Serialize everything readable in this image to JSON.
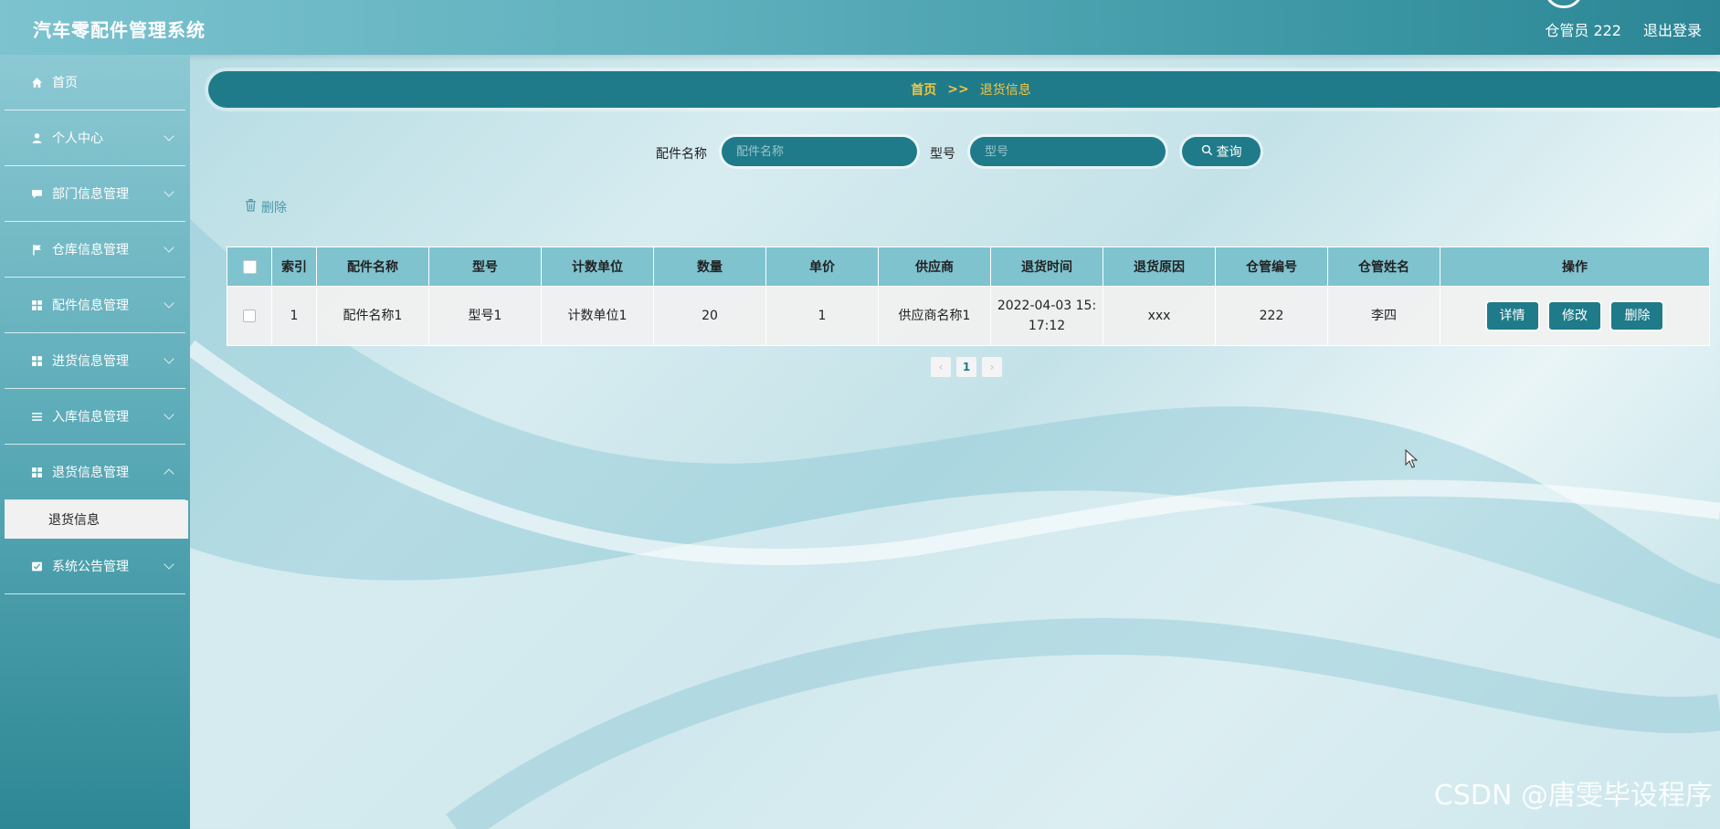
{
  "header": {
    "app_title": "汽车零配件管理系统",
    "user_label": "仓管员 222",
    "logout_label": "退出登录"
  },
  "sidebar": {
    "items": [
      {
        "label": "首页",
        "icon": "home-icon"
      },
      {
        "label": "个人中心",
        "icon": "user-icon"
      },
      {
        "label": "部门信息管理",
        "icon": "chat-icon"
      },
      {
        "label": "仓库信息管理",
        "icon": "flag-icon"
      },
      {
        "label": "配件信息管理",
        "icon": "grid-icon"
      },
      {
        "label": "进货信息管理",
        "icon": "grid-icon"
      },
      {
        "label": "入库信息管理",
        "icon": "list-icon"
      },
      {
        "label": "退货信息管理",
        "icon": "grid-icon"
      },
      {
        "label": "系统公告管理",
        "icon": "notice-icon"
      }
    ],
    "active_sub": "退货信息"
  },
  "breadcrumb": {
    "home": "首页",
    "separator": ">>",
    "current": "退货信息"
  },
  "search": {
    "name_label": "配件名称",
    "name_placeholder": "配件名称",
    "model_label": "型号",
    "model_placeholder": "型号",
    "query_label": "查询"
  },
  "toolbar": {
    "delete_label": "删除"
  },
  "table": {
    "columns": [
      "索引",
      "配件名称",
      "型号",
      "计数单位",
      "数量",
      "单价",
      "供应商",
      "退货时间",
      "退货原因",
      "仓管编号",
      "仓管姓名",
      "操作"
    ],
    "rows": [
      {
        "index": "1",
        "part_name": "配件名称1",
        "model": "型号1",
        "unit": "计数单位1",
        "quantity": "20",
        "price": "1",
        "supplier": "供应商名称1",
        "return_time": "2022-04-03 15:17:12",
        "reason": "xxx",
        "keeper_no": "222",
        "keeper_name": "李四",
        "actions": [
          "详情",
          "修改",
          "删除"
        ]
      }
    ]
  },
  "pagination": {
    "current_page": "1",
    "prev": "‹",
    "next": "›"
  },
  "watermark": "CSDN @唐雯毕设程序",
  "colors": {
    "primary": "#1f7b8a",
    "accent": "#f4c542",
    "header_light": "#7fc3cf"
  }
}
